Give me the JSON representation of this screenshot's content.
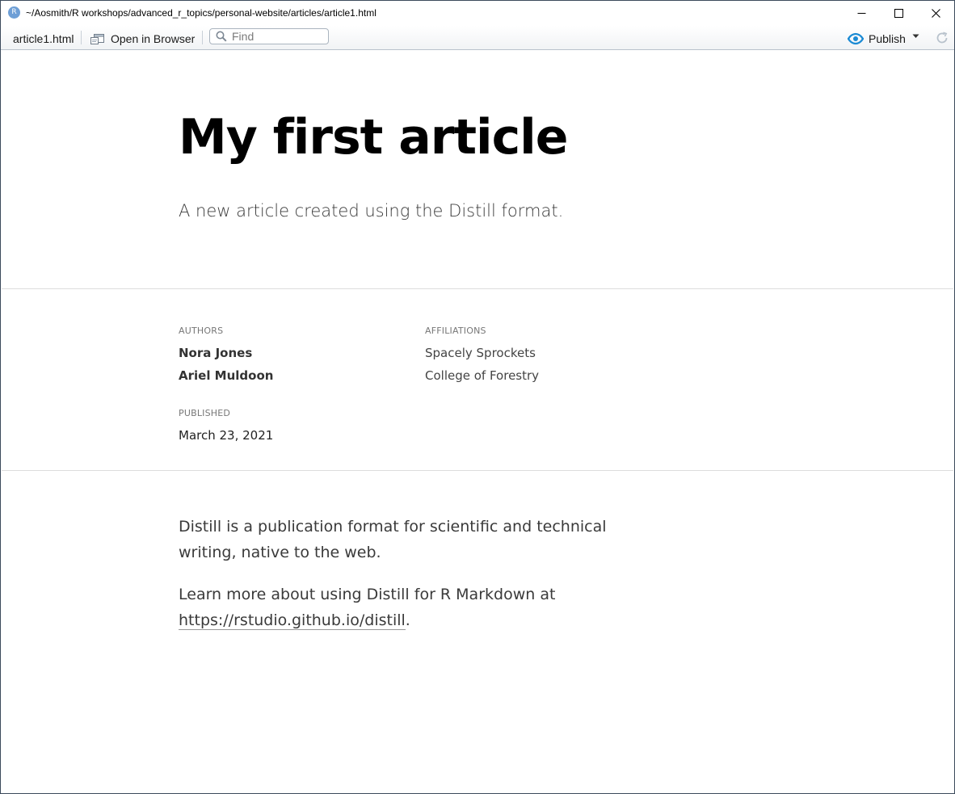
{
  "window": {
    "title": "~/Aosmith/R workshops/advanced_r_topics/personal-website/articles/article1.html",
    "app_icon_letter": "R"
  },
  "toolbar": {
    "file_tab": "article1.html",
    "open_in_browser": "Open in Browser",
    "find_placeholder": "Find",
    "publish": "Publish"
  },
  "article": {
    "title": "My first article",
    "description": "A new article created using the Distill format.",
    "authors_label": "AUTHORS",
    "affiliations_label": "AFFILIATIONS",
    "published_label": "PUBLISHED",
    "authors": [
      {
        "name": "Nora Jones",
        "affiliation": "Spacely Sprockets"
      },
      {
        "name": "Ariel Muldoon",
        "affiliation": "College of Forestry"
      }
    ],
    "published_date": "March 23, 2021",
    "body": {
      "para1": "Distill is a publication format for scientific and technical writing, native to the web.",
      "para2_text": "Learn more about using Distill for R Markdown at ",
      "para2_link": "https://rstudio.github.io/distill",
      "para2_end": "."
    }
  },
  "colors": {
    "publish_accent": "#1a8ad4",
    "window_border": "#3c4a5c",
    "divider": "#dddddd"
  },
  "icons": {
    "app": "r-logo-icon",
    "open_in_browser": "browser-window-icon",
    "find": "magnifier-icon",
    "publish": "publish-eye-icon",
    "publish_menu": "caret-down-icon",
    "refresh": "refresh-icon",
    "minimize": "minimize-icon",
    "maximize": "maximize-icon",
    "close": "close-icon"
  }
}
